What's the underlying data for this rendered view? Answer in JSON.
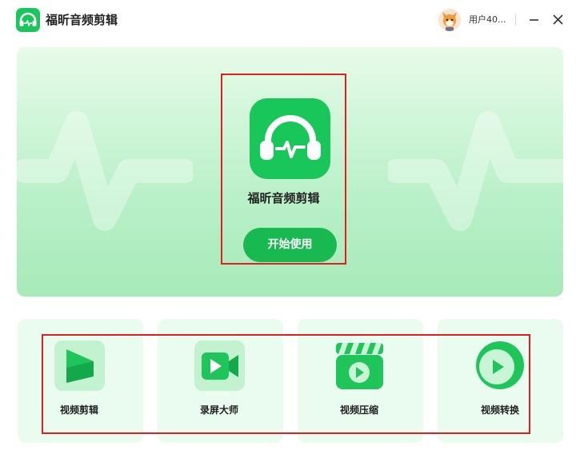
{
  "app": {
    "title": "福昕音频剪辑",
    "username": "用户40..."
  },
  "window_controls": {
    "minimize_icon": "minimize-icon",
    "close_icon": "close-icon"
  },
  "hero": {
    "title": "福昕音频剪辑",
    "start_label": "开始使用"
  },
  "tools": [
    {
      "label": "视频剪辑",
      "icon": "video-edit-icon"
    },
    {
      "label": "录屏大师",
      "icon": "screen-record-icon"
    },
    {
      "label": "视频压缩",
      "icon": "video-compress-icon"
    },
    {
      "label": "视频转换",
      "icon": "video-convert-icon"
    }
  ],
  "colors": {
    "brand_green": "#19c65a",
    "button_green": "#17b950",
    "highlight_red": "#e02020"
  }
}
